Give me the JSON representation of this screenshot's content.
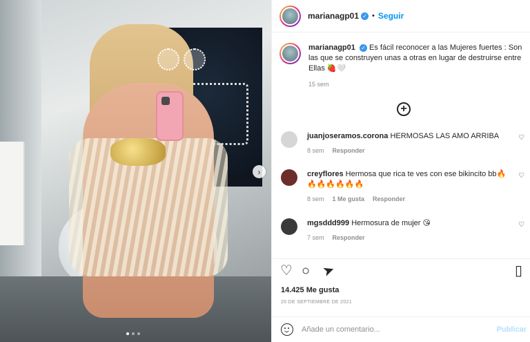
{
  "post": {
    "username": "marianagp01",
    "follow_label": "Seguir",
    "separator": "•",
    "caption": "Es fácil reconocer a las Mujeres fuertes : Son las que se construyen unas a otras en lugar de destruirse entre Ellas 🍓🤍",
    "caption_time": "15 sem",
    "next_label": "›"
  },
  "comments": [
    {
      "username": "juanjoseramos.corona",
      "text": "HERMOSAS LAS AMO ARRIBA",
      "time": "8 sem",
      "reply": "Responder",
      "likes": "",
      "avatar_color": "#d6d6d6"
    },
    {
      "username": "creyflores",
      "text": "Hermosa que rica te ves con ese bikincito bb🔥🔥🔥🔥🔥🔥🔥",
      "time": "8 sem",
      "reply": "Responder",
      "likes": "1 Me gusta",
      "avatar_color": "#6b2e2a"
    },
    {
      "username": "mgsddd999",
      "text": "Hermosura de mujer 😘",
      "time": "7 sem",
      "reply": "Responder",
      "likes": "",
      "avatar_color": "#3a3a3a"
    }
  ],
  "actions": {
    "like_icon": "♡",
    "comment_icon": "○",
    "share_icon": "➤",
    "save_icon": "▯"
  },
  "likes_text": "14.425 Me gusta",
  "date_text": "20 DE SEPTIEMBRE DE 2021",
  "add_comment": {
    "placeholder": "Añade un comentario...",
    "publish_label": "Publicar"
  },
  "colors": {
    "accent": "#0095f6",
    "verified": "#3897f0",
    "muted": "#8e8e8e",
    "publish_disabled": "#b2dffc"
  }
}
